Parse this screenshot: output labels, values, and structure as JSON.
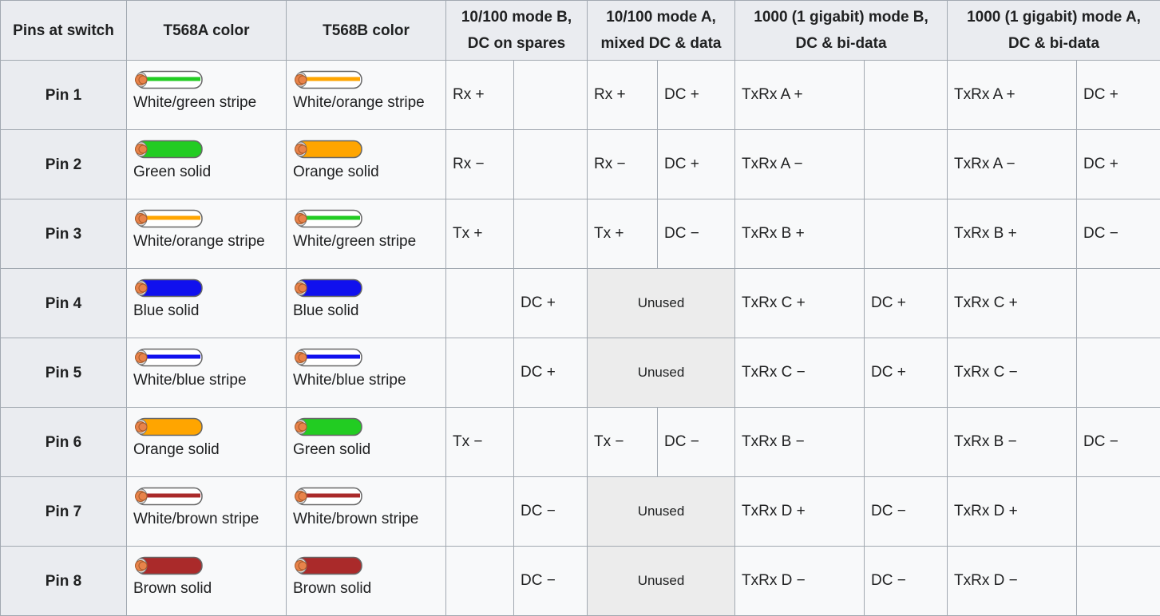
{
  "headers": [
    "Pins at switch",
    "T568A color",
    "T568B color",
    "10/100 mode B, DC on spares",
    "10/100 mode A, mixed DC & data",
    "1000 (1 gigabit) mode B, DC & bi-data",
    "1000 (1 gigabit) mode A, DC & bi-data"
  ],
  "colors": {
    "white": "#ffffff",
    "green": "#22cc22",
    "orange": "#ffa500",
    "blue": "#1010ee",
    "brown": "#aa2a2a",
    "copper": "#e8834a"
  },
  "rows": [
    {
      "pin": "Pin 1",
      "a": {
        "label": "White/green stripe",
        "color": "green",
        "striped": true
      },
      "b": {
        "label": "White/orange stripe",
        "color": "orange",
        "striped": true
      },
      "m1": [
        "Rx +",
        ""
      ],
      "m2": [
        "Rx +",
        "DC +"
      ],
      "g1": [
        "TxRx A +",
        ""
      ],
      "g2": [
        "TxRx A +",
        "DC +"
      ]
    },
    {
      "pin": "Pin 2",
      "a": {
        "label": "Green solid",
        "color": "green",
        "striped": false
      },
      "b": {
        "label": "Orange solid",
        "color": "orange",
        "striped": false
      },
      "m1": [
        "Rx −",
        ""
      ],
      "m2": [
        "Rx −",
        "DC +"
      ],
      "g1": [
        "TxRx A −",
        ""
      ],
      "g2": [
        "TxRx A −",
        "DC +"
      ]
    },
    {
      "pin": "Pin 3",
      "a": {
        "label": "White/orange stripe",
        "color": "orange",
        "striped": true
      },
      "b": {
        "label": "White/green stripe",
        "color": "green",
        "striped": true
      },
      "m1": [
        "Tx +",
        ""
      ],
      "m2": [
        "Tx +",
        "DC −"
      ],
      "g1": [
        "TxRx B +",
        ""
      ],
      "g2": [
        "TxRx B +",
        "DC −"
      ]
    },
    {
      "pin": "Pin 4",
      "a": {
        "label": "Blue solid",
        "color": "blue",
        "striped": false
      },
      "b": {
        "label": "Blue solid",
        "color": "blue",
        "striped": false
      },
      "m1": [
        "",
        "DC +"
      ],
      "m2": "Unused",
      "g1": [
        "TxRx C +",
        "DC +"
      ],
      "g2": [
        "TxRx C +",
        ""
      ]
    },
    {
      "pin": "Pin 5",
      "a": {
        "label": "White/blue stripe",
        "color": "blue",
        "striped": true
      },
      "b": {
        "label": "White/blue stripe",
        "color": "blue",
        "striped": true
      },
      "m1": [
        "",
        "DC +"
      ],
      "m2": "Unused",
      "g1": [
        "TxRx C −",
        "DC +"
      ],
      "g2": [
        "TxRx C −",
        ""
      ]
    },
    {
      "pin": "Pin 6",
      "a": {
        "label": "Orange solid",
        "color": "orange",
        "striped": false
      },
      "b": {
        "label": "Green solid",
        "color": "green",
        "striped": false
      },
      "m1": [
        "Tx −",
        ""
      ],
      "m2": [
        "Tx −",
        "DC −"
      ],
      "g1": [
        "TxRx B −",
        ""
      ],
      "g2": [
        "TxRx B −",
        "DC −"
      ]
    },
    {
      "pin": "Pin 7",
      "a": {
        "label": "White/brown stripe",
        "color": "brown",
        "striped": true
      },
      "b": {
        "label": "White/brown stripe",
        "color": "brown",
        "striped": true
      },
      "m1": [
        "",
        "DC −"
      ],
      "m2": "Unused",
      "g1": [
        "TxRx D +",
        "DC −"
      ],
      "g2": [
        "TxRx D +",
        ""
      ]
    },
    {
      "pin": "Pin 8",
      "a": {
        "label": "Brown solid",
        "color": "brown",
        "striped": false
      },
      "b": {
        "label": "Brown solid",
        "color": "brown",
        "striped": false
      },
      "m1": [
        "",
        "DC −"
      ],
      "m2": "Unused",
      "g1": [
        "TxRx D −",
        "DC −"
      ],
      "g2": [
        "TxRx D −",
        ""
      ]
    }
  ]
}
